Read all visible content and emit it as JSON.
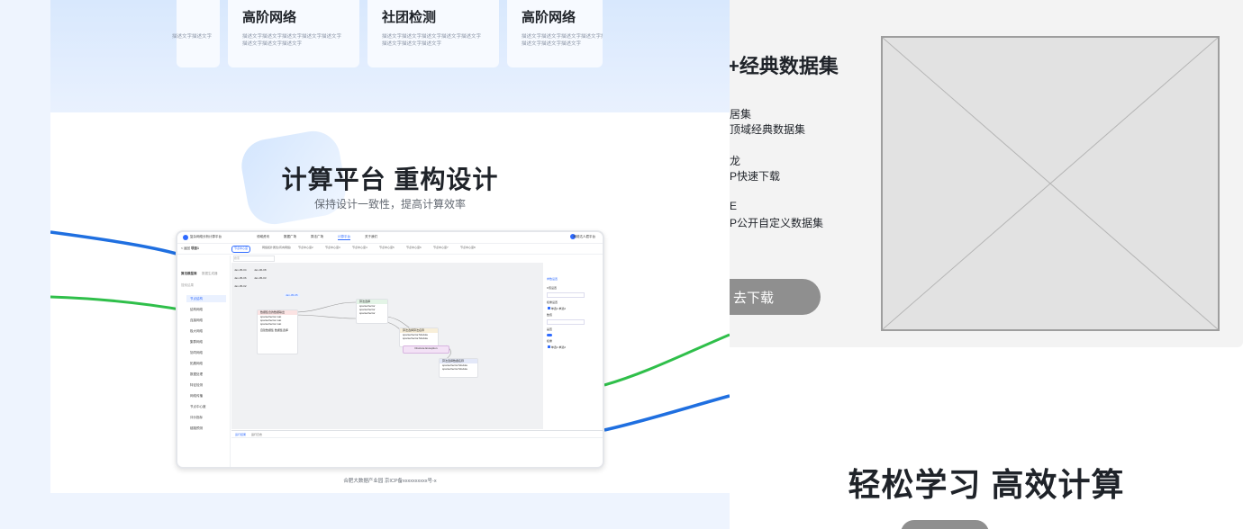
{
  "cards": [
    {
      "title": "",
      "desc": [
        "描述文字描述文字",
        ""
      ]
    },
    {
      "title": "高阶网络",
      "desc": [
        "描述文字描述文字描述文字描述文字描述文字",
        "描述文字描述文字描述文字"
      ]
    },
    {
      "title": "社团检测",
      "desc": [
        "描述文字描述文字描述文字描述文字描述文字",
        "描述文字描述文字描述文字"
      ]
    },
    {
      "title": "高阶网络",
      "desc": [
        "描述文字描述文字描述文字描述文字描述文字",
        "描述文字描述文字描述文字"
      ]
    }
  ],
  "hero": {
    "title": "计算平台 重构设计",
    "subtitle": "保持设计一致性，提高计算效率"
  },
  "footer": "合肥大数据产业园 京ICP备xxxxxxxxxx号-x",
  "mock": {
    "brand": "复杂网络分析计算平台",
    "nav": [
      "领域资讯",
      "数据广场",
      "算法广场",
      "计算平台",
      "关于我们"
    ],
    "user": "网络达人君平台",
    "project": "项目1",
    "back": "< 返回",
    "tabs": [
      "节点中心度",
      "网络拓扑属性(有向网络)",
      "节点中心度2",
      "节点中心度3",
      "节点中心度4",
      "节点中心度5",
      "节点中心度6",
      "节点中心度7",
      "节点中心度8",
      "节点中"
    ],
    "sidebar": [
      "算法模型库",
      "搜索结果",
      "节点结构",
      "结构网络",
      "连接网络",
      "极大网络",
      "集群网络",
      "协同网络",
      "拓展网络",
      "数据处理",
      "特征检测",
      "网络传播",
      "节点中心度",
      "评价指标",
      "链路预测"
    ],
    "sidebar_extra": "数据生成器",
    "search_hint": "搜索",
    "list": [
      "Jan-05-04",
      "Jan-06-08",
      "Jan-05-06",
      "Jan-05-03",
      "Jan-05-02"
    ],
    "tip": "Jan-05-05",
    "nodes": [
      {
        "title": "数据集合的数据输出",
        "rows": [
          "sparseVector.mat",
          "sparseVector.mat",
          "sparseVector.mat"
        ],
        "foot": [
          "自建数据集",
          "数据集选择"
        ]
      },
      {
        "title": "算法选择",
        "rows": [
          "sparseVector",
          "sparseVector",
          "sparseVector"
        ]
      },
      {
        "title": "算法选择算法名称",
        "rows": [
          "sparseVector.Module",
          "sparseVector.Module"
        ]
      },
      {
        "title": "Discrete Exception",
        "rows": []
      },
      {
        "title": "算法选择数据名称",
        "rows": [
          "sparseVector.Module",
          "sparseVector.Module"
        ]
      }
    ],
    "panel": {
      "title": "参数设置",
      "fields": [
        "K值设置",
        "数值",
        "权重设置",
        "参数",
        "是否",
        "开关",
        "权重"
      ],
      "opts": [
        "单选1",
        "单选2"
      ]
    },
    "bottom_tabs": [
      "运行结果",
      "运行日志"
    ]
  },
  "right": {
    "title": "+经典数据集",
    "items": [
      {
        "a": "居集",
        "b": "顶域经典数据集"
      },
      {
        "a": "龙",
        "b": "P快速下载"
      },
      {
        "a": "E",
        "b": "P公开自定义数据集"
      }
    ],
    "button": "去下载",
    "bottom_title": "轻松学习 高效计算"
  },
  "colors": {
    "blue_curve": "#1f6fe0",
    "green_curve": "#2fbf4a",
    "accent": "#2f6bff",
    "button_gray": "#8f8f8f"
  }
}
